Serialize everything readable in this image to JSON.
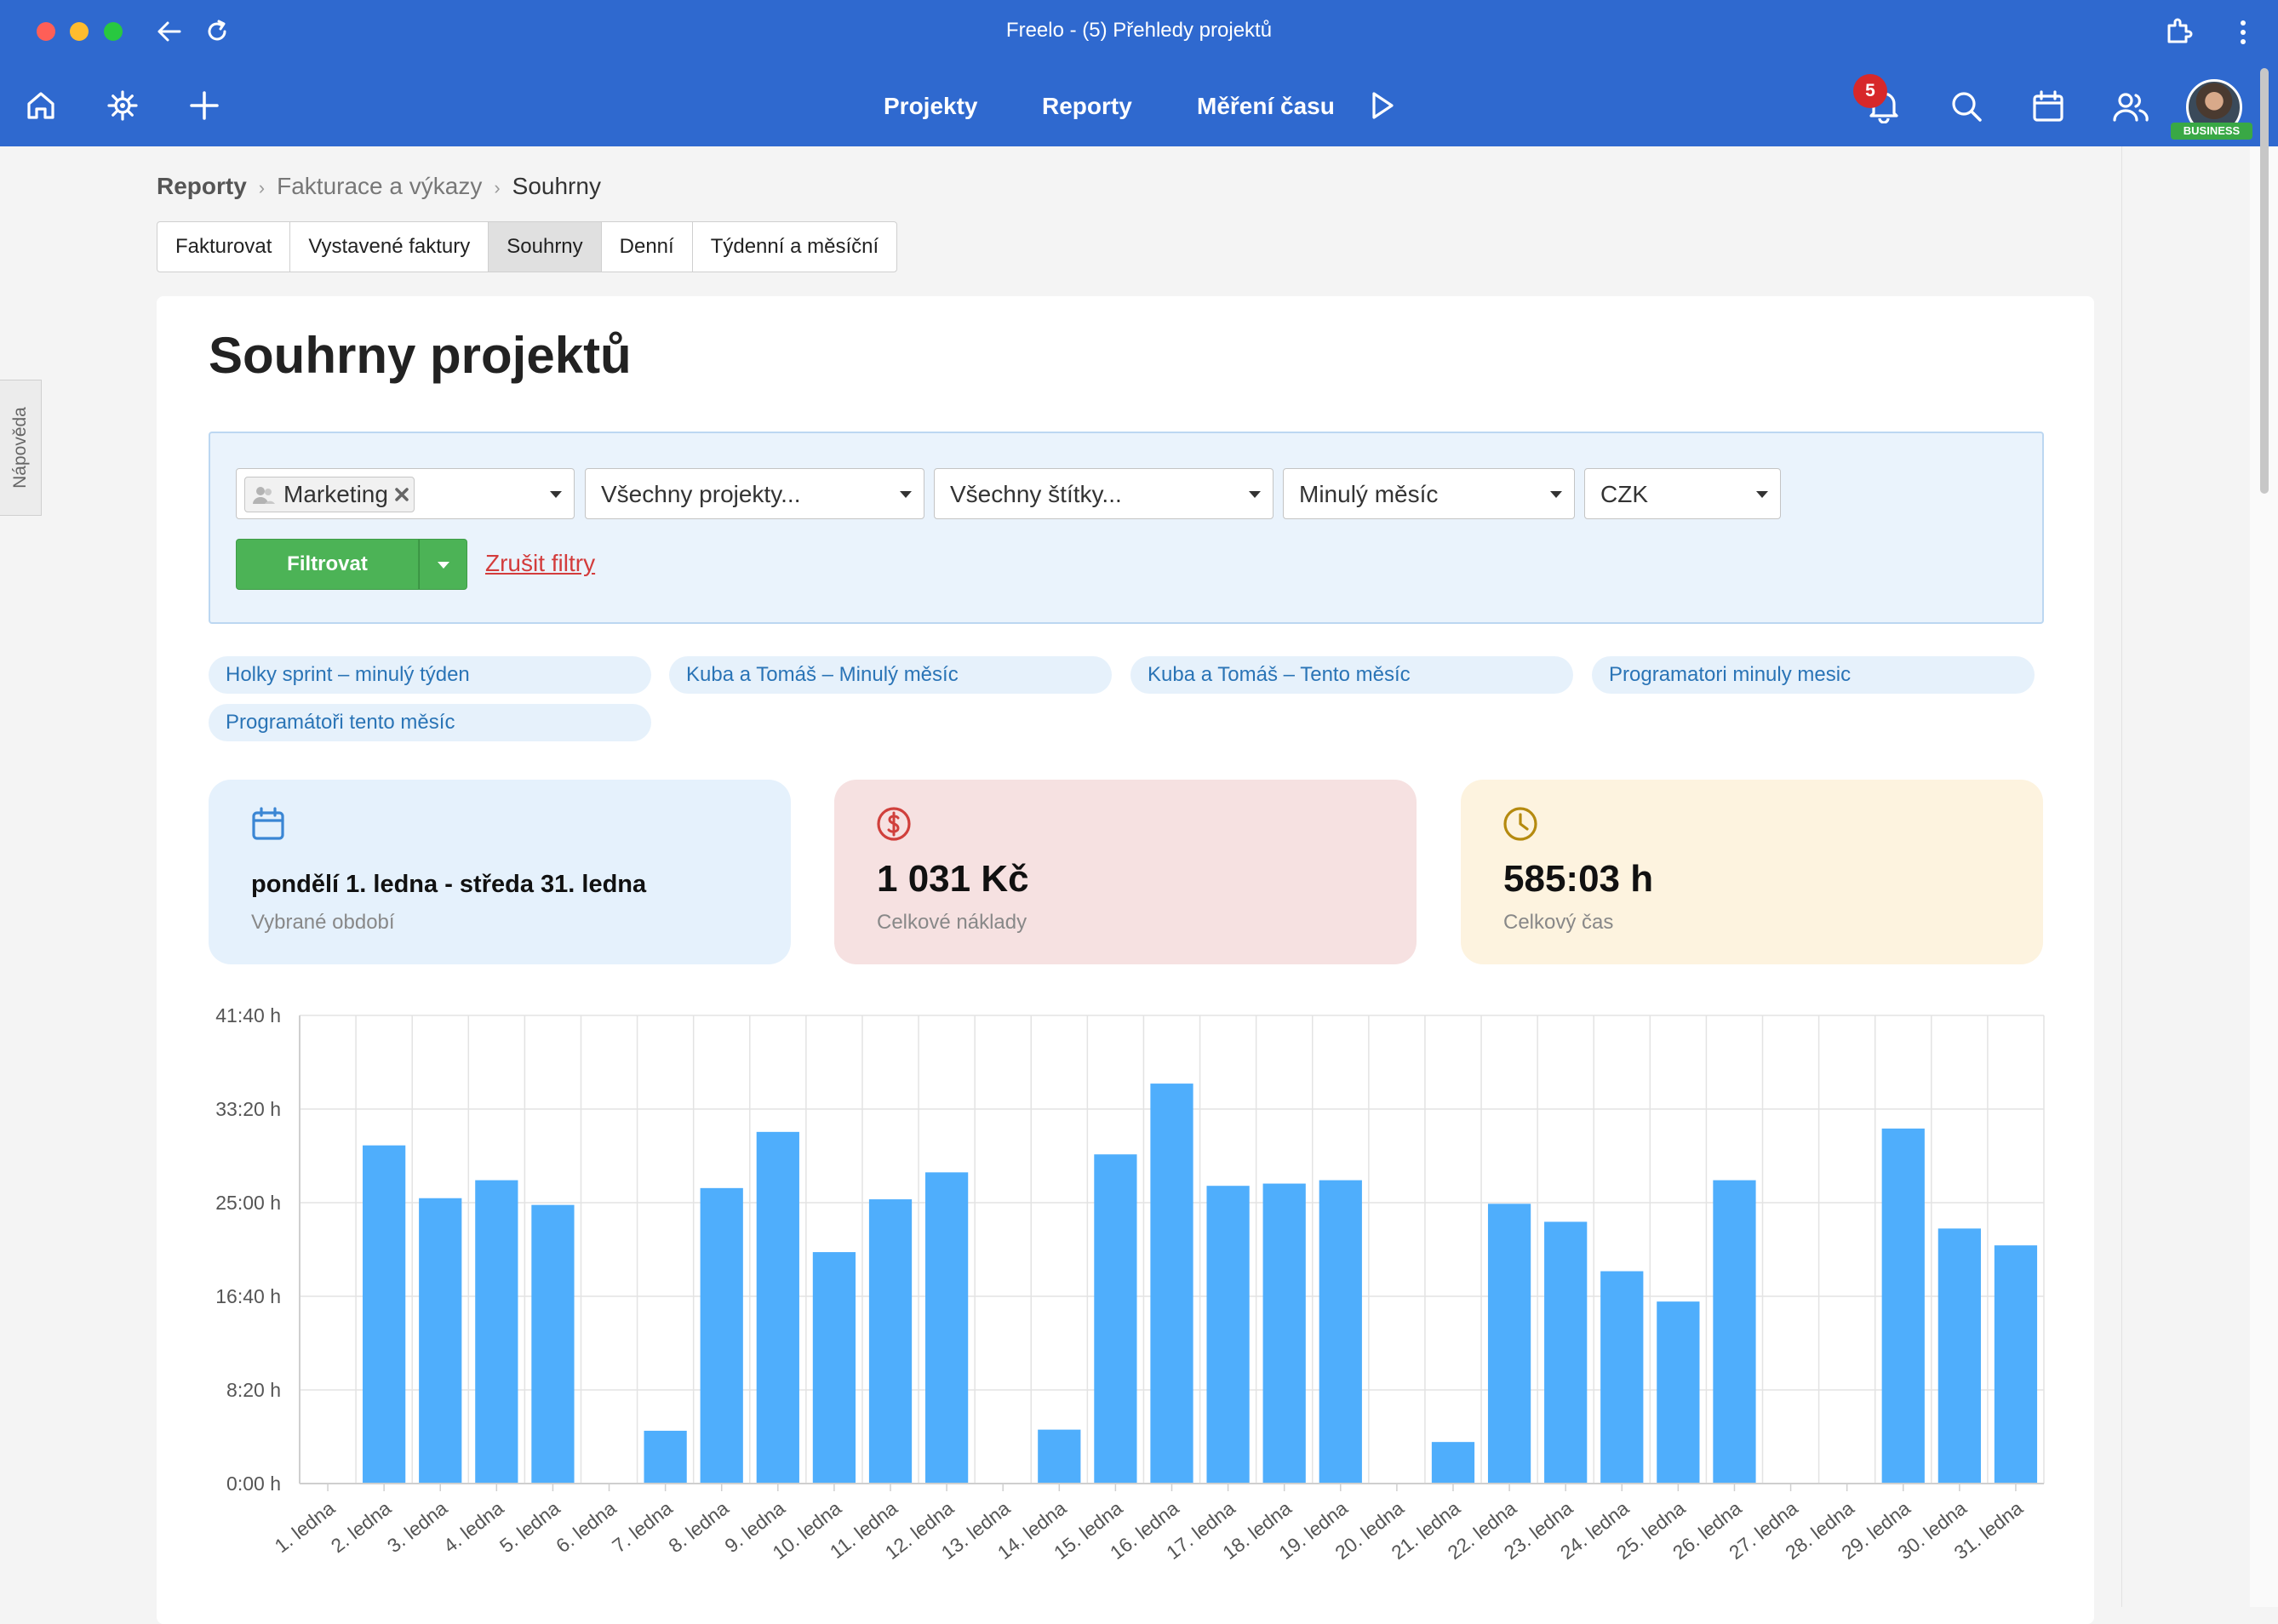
{
  "window": {
    "title": "Freelo - (5) Přehledy projektů"
  },
  "nav": {
    "links": [
      "Projekty",
      "Reporty",
      "Měření času"
    ],
    "notifications": "5",
    "plan_badge": "BUSINESS",
    "icons": [
      "home-icon",
      "settings-icon",
      "plus-icon",
      "play-icon",
      "bell-icon",
      "search-icon",
      "calendar-icon",
      "users-icon"
    ]
  },
  "help_tab": "Nápověda",
  "breadcrumb": [
    "Reporty",
    "Fakturace a výkazy",
    "Souhrny"
  ],
  "tabs": [
    {
      "label": "Fakturovat",
      "active": false
    },
    {
      "label": "Vystavené faktury",
      "active": false
    },
    {
      "label": "Souhrny",
      "active": true
    },
    {
      "label": "Denní",
      "active": false
    },
    {
      "label": "Týdenní a měsíční",
      "active": false
    }
  ],
  "page_title": "Souhrny projektů",
  "filters": {
    "team_chip": "Marketing",
    "projects": "Všechny projekty...",
    "tags": "Všechny štítky...",
    "period": "Minulý měsíc",
    "currency": "CZK",
    "filter_button": "Filtrovat",
    "clear_link": "Zrušit filtry"
  },
  "saved_filters": [
    "Holky sprint – minulý týden",
    "Kuba a Tomáš – Minulý měsíc",
    "Kuba a Tomáš – Tento měsíc",
    "Programatori minuly mesic",
    "Programátoři tento měsíc"
  ],
  "stats": {
    "period": {
      "value": "pondělí 1. ledna - středa 31. ledna",
      "label": "Vybrané období"
    },
    "cost": {
      "value": "1 031 Kč",
      "label": "Celkové náklady"
    },
    "time": {
      "value": "585:03 h",
      "label": "Celkový čas"
    }
  },
  "colors": {
    "brand": "#2f69cf",
    "bar": "#4faefc",
    "filter_green": "#4cb356",
    "link_red": "#d33c3c"
  },
  "chart_data": {
    "type": "bar",
    "title": "",
    "xlabel": "",
    "ylabel": "",
    "grid": true,
    "categories": [
      "1. ledna",
      "2. ledna",
      "3. ledna",
      "4. ledna",
      "5. ledna",
      "6. ledna",
      "7. ledna",
      "8. ledna",
      "9. ledna",
      "10. ledna",
      "11. ledna",
      "12. ledna",
      "13. ledna",
      "14. ledna",
      "15. ledna",
      "16. ledna",
      "17. ledna",
      "18. ledna",
      "19. ledna",
      "20. ledna",
      "21. ledna",
      "22. ledna",
      "23. ledna",
      "24. ledna",
      "25. ledna",
      "26. ledna",
      "27. ledna",
      "28. ledna",
      "29. ledna",
      "30. ledna",
      "31. ledna"
    ],
    "values_hours": [
      0,
      30.1,
      25.4,
      27.0,
      24.8,
      0,
      4.7,
      26.3,
      31.3,
      20.6,
      25.3,
      27.7,
      0,
      4.8,
      29.3,
      35.6,
      26.5,
      26.7,
      27.0,
      0,
      3.7,
      24.9,
      23.3,
      18.9,
      16.2,
      27.0,
      0,
      0,
      31.6,
      22.7,
      21.2
    ],
    "y_ticks": [
      "0:00 h",
      "8:20 h",
      "16:40 h",
      "25:00 h",
      "33:20 h",
      "41:40 h"
    ],
    "ylim_hours": [
      0,
      41.667
    ]
  }
}
